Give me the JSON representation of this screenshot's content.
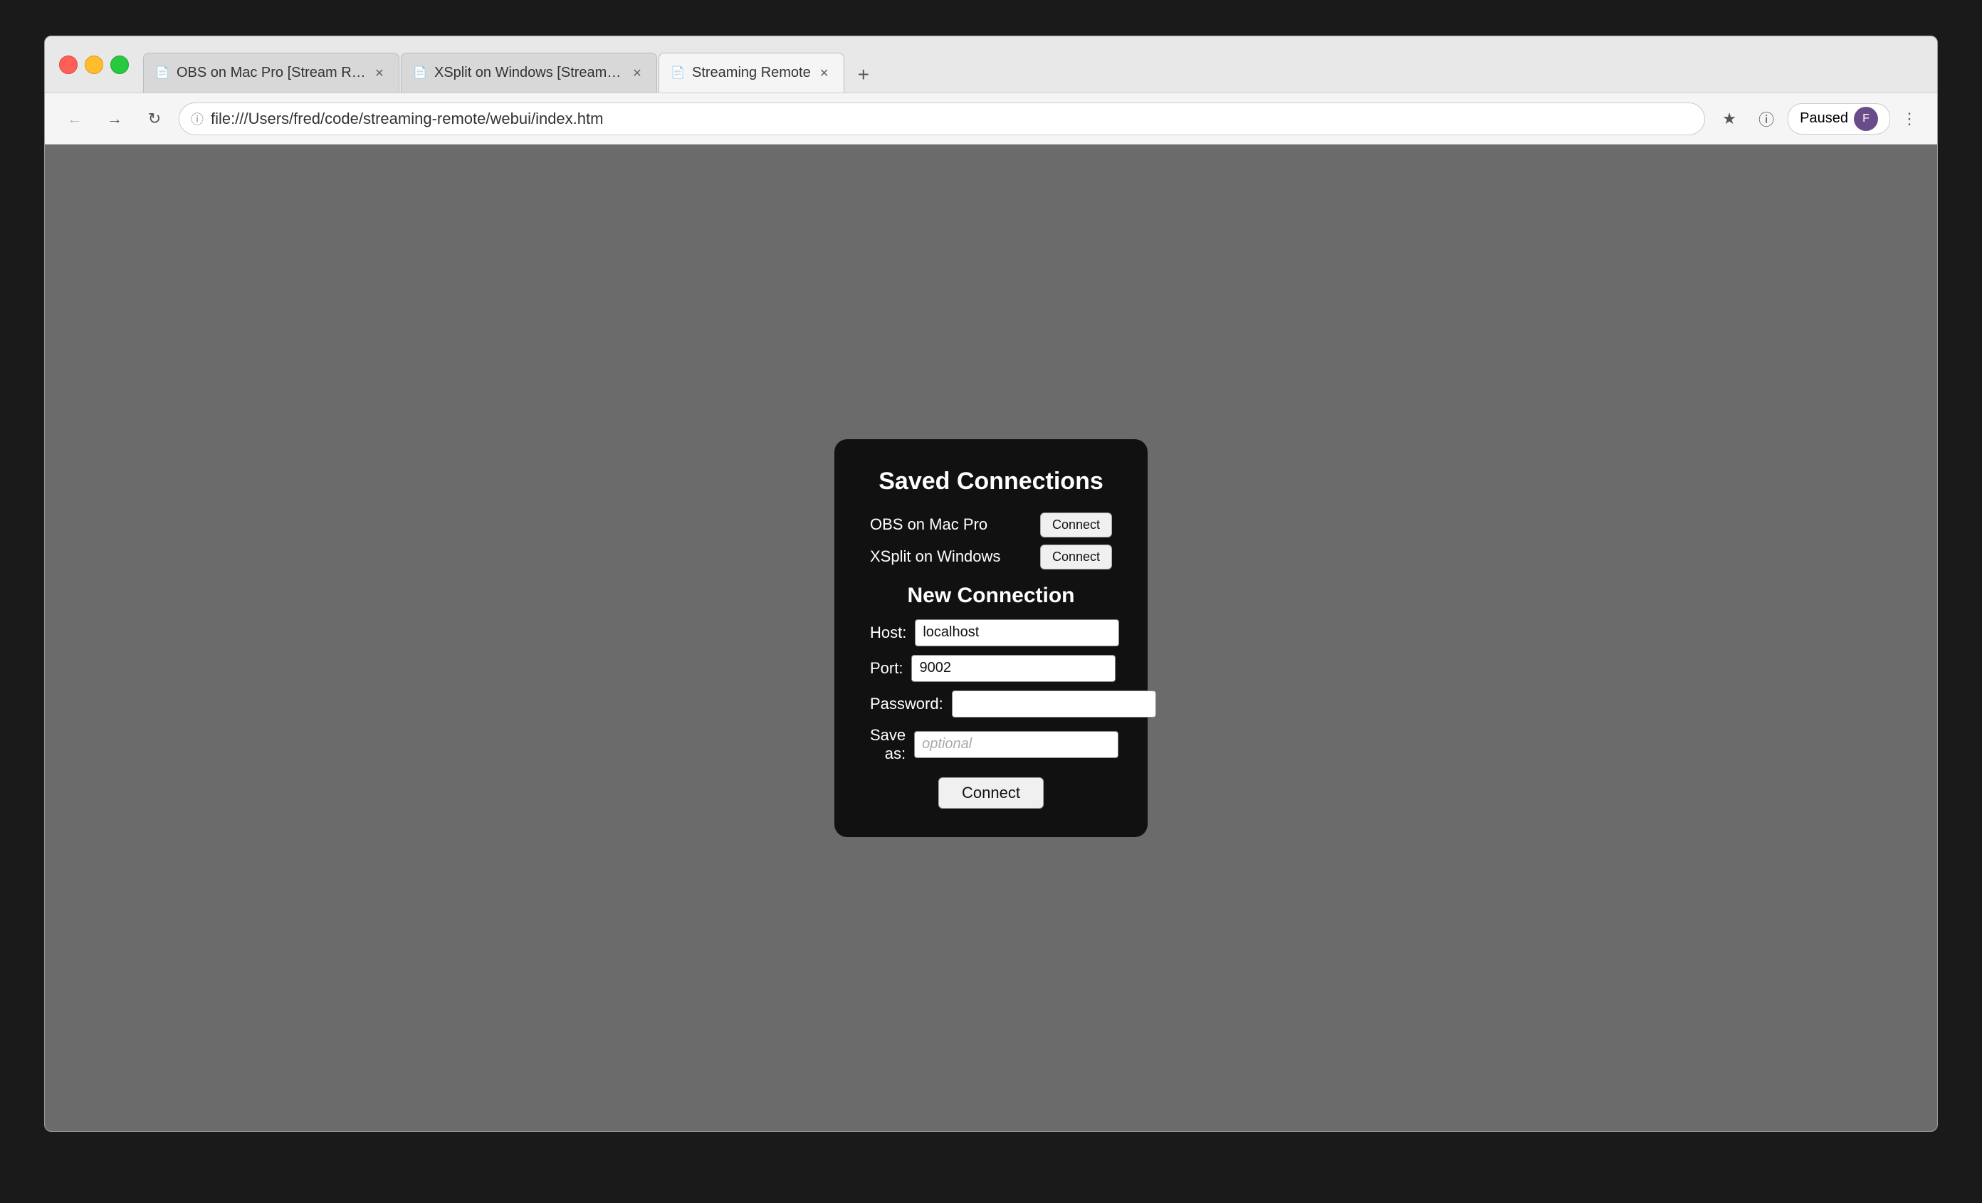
{
  "browser": {
    "tabs": [
      {
        "id": "tab1",
        "label": "OBS on Mac Pro [Stream Rem...",
        "active": false,
        "favicon": "📄"
      },
      {
        "id": "tab2",
        "label": "XSplit on Windows [Stream Re...",
        "active": false,
        "favicon": "📄"
      },
      {
        "id": "tab3",
        "label": "Streaming Remote",
        "active": true,
        "favicon": "📄"
      }
    ],
    "address": "file:///Users/fred/code/streaming-remote/webui/index.htm",
    "paused_label": "Paused",
    "new_tab_label": "+"
  },
  "page": {
    "card": {
      "saved_connections_title": "Saved Connections",
      "new_connection_title": "New Connection",
      "saved": [
        {
          "name": "OBS on Mac Pro",
          "button": "Connect"
        },
        {
          "name": "XSplit on Windows",
          "button": "Connect"
        }
      ],
      "form": {
        "host_label": "Host:",
        "host_value": "localhost",
        "port_label": "Port:",
        "port_value": "9002",
        "password_label": "Password:",
        "password_value": "",
        "save_as_label": "Save as:",
        "save_as_placeholder": "optional",
        "connect_label": "Connect"
      }
    }
  }
}
